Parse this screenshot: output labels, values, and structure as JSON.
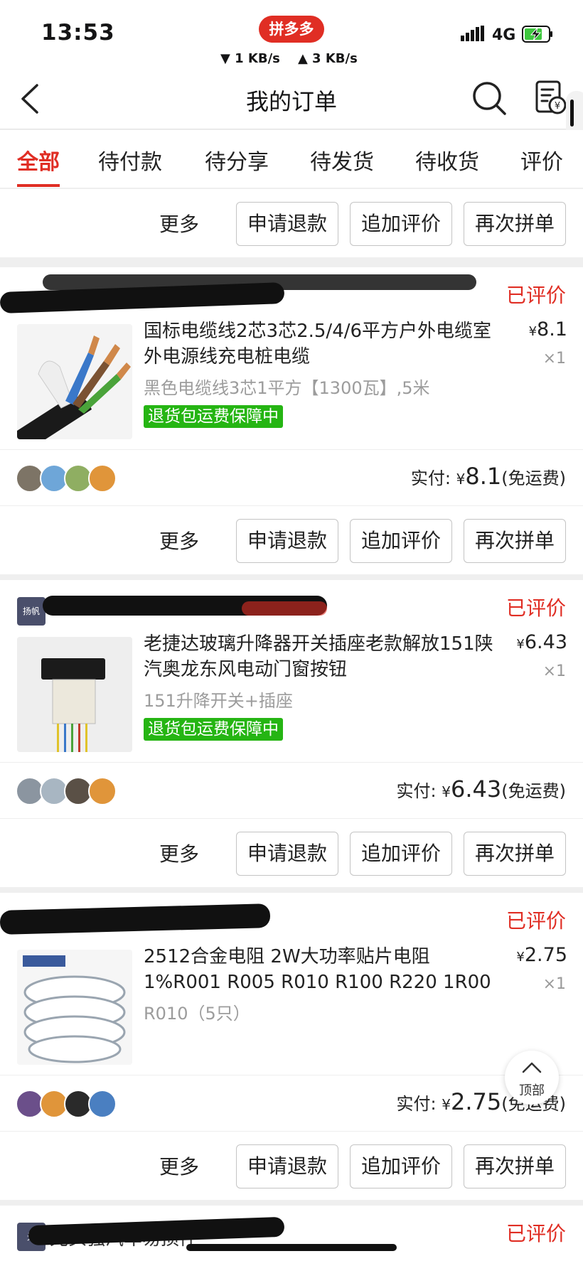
{
  "status_bar": {
    "time": "13:53",
    "app_badge": "拼多多",
    "download_speed": "▼ 1 KB/s",
    "upload_speed": "▲ 3 KB/s",
    "network": "4G"
  },
  "nav": {
    "title": "我的订单"
  },
  "tabs": [
    "全部",
    "待付款",
    "待分享",
    "待发货",
    "待收货",
    "评价"
  ],
  "actions": {
    "more": "更多",
    "refund": "申请退款",
    "add_review": "追加评价",
    "reorder": "再次拼单"
  },
  "orders": [
    {
      "status": "已评价",
      "goods_name": "国标电缆线2芯3芯2.5/4/6平方户外电缆室外电源线充电桩电缆",
      "spec": "黑色电缆线3芯1平方【1300瓦】,5米",
      "tag": "退货包运费保障中",
      "currency": "¥",
      "price": "8.1",
      "qty": "×1",
      "paid_label": "实付:",
      "paid_amount": "8.1",
      "shipping": "(免运费)"
    },
    {
      "shop_logo": "扬帆",
      "status": "已评价",
      "goods_name": "老捷达玻璃升降器开关插座老款解放151陕汽奥龙东风电动门窗按钮",
      "spec": "151升降开关+插座",
      "tag": "退货包运费保障中",
      "currency": "¥",
      "price": "6.43",
      "qty": "×1",
      "paid_label": "实付:",
      "paid_amount": "6.43",
      "shipping": "(免运费)"
    },
    {
      "status": "已评价",
      "goods_name": "2512合金电阻 2W大功率贴片电阻1%R001 R005 R010 R100 R220 1R00",
      "spec": "R010（5只）",
      "currency": "¥",
      "price": "2.75",
      "qty": "×1",
      "paid_label": "实付:",
      "paid_amount": "2.75",
      "shipping": "(免运费)"
    },
    {
      "shop_logo": "光",
      "shop_name": "光头强汽车易损件",
      "status": "已评价"
    }
  ],
  "back_to_top": "顶部",
  "colors": {
    "brand_red": "#e02e24",
    "guarantee_green": "#25b513"
  }
}
